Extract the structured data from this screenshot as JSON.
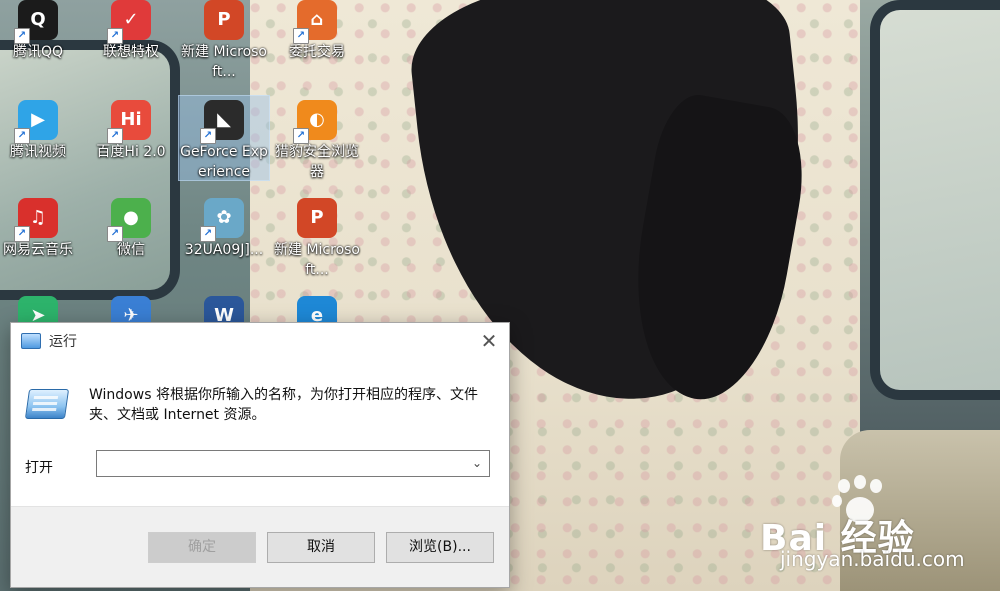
{
  "desktop": {
    "icons": [
      {
        "label": "腾讯QQ",
        "icon": "qq-icon",
        "glyph": "Q",
        "color": "#1b1b1b"
      },
      {
        "label": "联想特权",
        "icon": "lenovo-icon",
        "glyph": "✓",
        "color": "#e03a3a"
      },
      {
        "label": "新建 Microsoft...",
        "icon": "powerpoint-file-icon",
        "glyph": "P",
        "color": "#d24726"
      },
      {
        "label": "委托交易",
        "icon": "trade-icon",
        "glyph": "⌂",
        "color": "#e46b2c"
      },
      {
        "label": "腾讯视频",
        "icon": "tencent-video-icon",
        "glyph": "▶",
        "color": "#2fa4e7"
      },
      {
        "label": "百度Hi 2.0",
        "icon": "baidu-hi-icon",
        "glyph": "Hi",
        "color": "#e84b3c"
      },
      {
        "label": "GeForce Experience",
        "icon": "geforce-icon",
        "glyph": "◣",
        "color": "#2b2b2b"
      },
      {
        "label": "猎豹安全浏览器",
        "icon": "cheetah-browser-icon",
        "glyph": "◐",
        "color": "#f08a1c"
      },
      {
        "label": "网易云音乐",
        "icon": "netease-music-icon",
        "glyph": "♫",
        "color": "#d9302c"
      },
      {
        "label": "微信",
        "icon": "wechat-icon",
        "glyph": "●",
        "color": "#4cb04c"
      },
      {
        "label": "32UA09J]...",
        "icon": "image-file-icon",
        "glyph": "✿",
        "color": "#6aa8c8"
      },
      {
        "label": "新建 Microsoft...",
        "icon": "powerpoint-file-icon",
        "glyph": "P",
        "color": "#d24726"
      },
      {
        "label": "",
        "icon": "green-app-icon",
        "glyph": "➤",
        "color": "#2db36b"
      },
      {
        "label": "",
        "icon": "bird-app-icon",
        "glyph": "✈",
        "color": "#3a7fd4"
      },
      {
        "label": "",
        "icon": "word-file-icon",
        "glyph": "W",
        "color": "#2b579a"
      },
      {
        "label": "",
        "icon": "ie-browser-icon",
        "glyph": "e",
        "color": "#1e88d6"
      }
    ]
  },
  "run_dialog": {
    "title": "运行",
    "description": "Windows 将根据你所输入的名称，为你打开相应的程序、文件夹、文档或 Internet 资源。",
    "open_label": "打开",
    "open_value": "",
    "buttons": {
      "ok": "确定",
      "cancel": "取消",
      "browse": "浏览(B)..."
    }
  },
  "watermark": {
    "brand": "Bai  经验",
    "url": "jingyan.baidu.com"
  }
}
